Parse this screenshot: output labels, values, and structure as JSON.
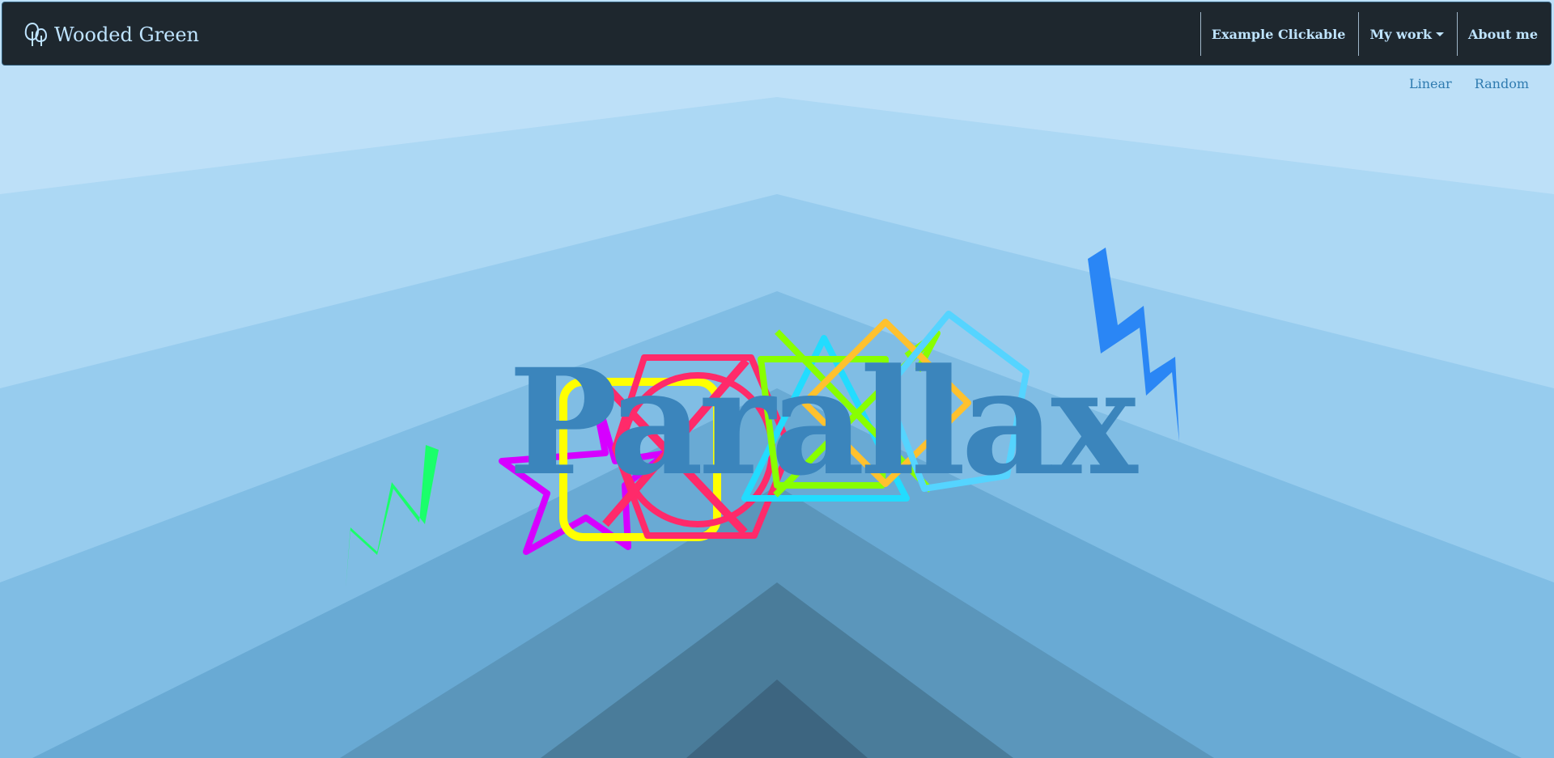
{
  "brand": {
    "name": "Wooded Green",
    "icon": "trees-icon"
  },
  "nav": {
    "items": [
      {
        "label": "Example Clickable"
      },
      {
        "label": "My work",
        "has_dropdown": true
      },
      {
        "label": "About me"
      }
    ]
  },
  "subnav": {
    "linear": "Linear",
    "random": "Random"
  },
  "hero": {
    "title": "Parallax"
  },
  "colors": {
    "navbar": "#1e272e",
    "nav_text": "#bfe4ff",
    "title": "#3b85bc",
    "background_layers": [
      "#bde0f8",
      "#acd8f4",
      "#97ccee",
      "#80bde4",
      "#69aad4",
      "#5b96bb",
      "#4a7c9a",
      "#3d6580"
    ],
    "shapes": {
      "lightning_green": "#1aff6a",
      "lightning_blue": "#2a86f5",
      "star": "#d600ff",
      "rounded_square": "#ffff00",
      "hexagon": "#ff2a6a",
      "cross": "#ff2a6a",
      "triangle": "#22dcff",
      "diamond_orange": "#ffc12e",
      "pentagon": "#55d4ff",
      "arrow": "#88ff00"
    }
  }
}
